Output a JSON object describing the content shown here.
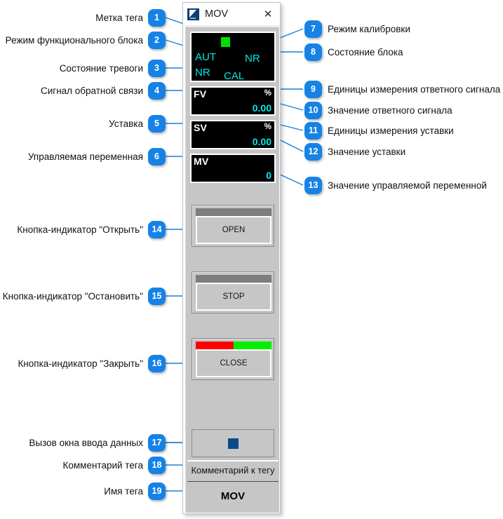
{
  "window": {
    "title": "MOV",
    "icon": "app-icon",
    "close_glyph": "✕"
  },
  "faceplate": {
    "status_panel": {
      "led": "green-indicator",
      "block_mode": "AUT",
      "alarm_state": "NR",
      "calibration_mode": "CAL",
      "block_status": "NR"
    },
    "values": [
      {
        "label": "FV",
        "unit": "%",
        "value": "0.00"
      },
      {
        "label": "SV",
        "unit": "%",
        "value": "0.00"
      },
      {
        "label": "MV",
        "unit": "",
        "value": "0"
      }
    ],
    "buttons": [
      {
        "label": "OPEN",
        "bar": "plain"
      },
      {
        "label": "STOP",
        "bar": "plain"
      },
      {
        "label": "CLOSE",
        "bar": "split"
      }
    ],
    "entry_button": "data-entry",
    "tag_comment": "Комментарий к тегу",
    "tag_name": "MOV"
  },
  "colors": {
    "badge": "#1682e6",
    "leader": "#1c7fd6",
    "panel_bg": "#c6c6c6",
    "display_bg": "#000000",
    "display_value": "#00e8e8",
    "led_green": "#00e000",
    "bar_red": "#ff0000",
    "bar_green": "#00f000",
    "entry_icon": "#0b4b8c"
  },
  "callouts": [
    {
      "n": "1",
      "text": "Метка тега"
    },
    {
      "n": "2",
      "text": "Режим функционального блока"
    },
    {
      "n": "3",
      "text": "Состояние тревоги"
    },
    {
      "n": "4",
      "text": "Сигнал обратной связи"
    },
    {
      "n": "5",
      "text": "Уставка"
    },
    {
      "n": "6",
      "text": "Управляемая переменная"
    },
    {
      "n": "7",
      "text": "Режим калибровки"
    },
    {
      "n": "8",
      "text": "Состояние блока"
    },
    {
      "n": "9",
      "text": "Единицы измерения ответного сигнала"
    },
    {
      "n": "10",
      "text": "Значение ответного сигнала"
    },
    {
      "n": "11",
      "text": "Единицы измерения уставки"
    },
    {
      "n": "12",
      "text": "Значение уставки"
    },
    {
      "n": "13",
      "text": "Значение управляемой переменной"
    },
    {
      "n": "14",
      "text": "Кнопка-индикатор \"Открыть\""
    },
    {
      "n": "15",
      "text": "Кнопка-индикатор \"Остановить\""
    },
    {
      "n": "16",
      "text": "Кнопка-индикатор \"Закрыть\""
    },
    {
      "n": "17",
      "text": "Вызов окна ввода данных"
    },
    {
      "n": "18",
      "text": "Комментарий тега"
    },
    {
      "n": "19",
      "text": "Имя тега"
    }
  ]
}
